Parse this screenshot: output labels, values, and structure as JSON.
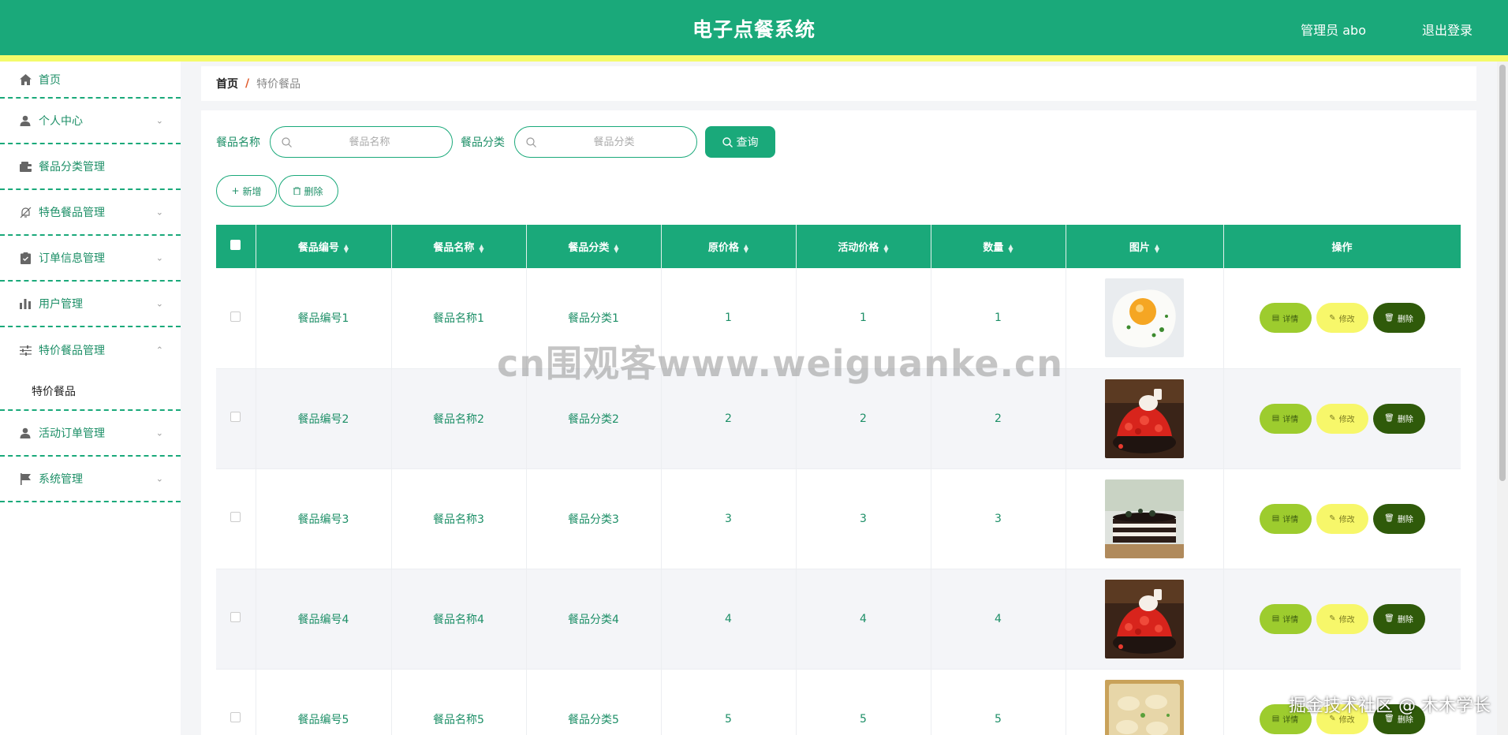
{
  "header": {
    "title": "电子点餐系统",
    "user": "管理员 abo",
    "logout": "退出登录"
  },
  "sidebar": {
    "items": [
      {
        "label": "首页",
        "icon": "home-icon"
      },
      {
        "label": "个人中心",
        "icon": "user-icon"
      },
      {
        "label": "餐品分类管理",
        "icon": "wallet-icon"
      },
      {
        "label": "特色餐品管理",
        "icon": "bell-off-icon"
      },
      {
        "label": "订单信息管理",
        "icon": "clipboard-icon"
      },
      {
        "label": "用户管理",
        "icon": "bar-chart-icon"
      },
      {
        "label": "特价餐品管理",
        "icon": "sliders-icon",
        "expanded": true,
        "children": [
          "特价餐品"
        ]
      },
      {
        "label": "活动订单管理",
        "icon": "user-icon"
      },
      {
        "label": "系统管理",
        "icon": "flag-icon"
      }
    ]
  },
  "breadcrumb": {
    "home": "首页",
    "separator": "/",
    "current": "特价餐品"
  },
  "search": {
    "name_label": "餐品名称",
    "name_placeholder": "餐品名称",
    "category_label": "餐品分类",
    "category_placeholder": "餐品分类",
    "query_button": "查询"
  },
  "actions": {
    "add": "新增",
    "delete": "删除"
  },
  "table": {
    "headers": [
      "餐品编号",
      "餐品名称",
      "餐品分类",
      "原价格",
      "活动价格",
      "数量",
      "图片",
      "操作"
    ],
    "rows": [
      {
        "code": "餐品编号1",
        "name": "餐品名称1",
        "category": "餐品分类1",
        "price": "1",
        "sale_price": "1",
        "qty": "1",
        "image": "fried-egg"
      },
      {
        "code": "餐品编号2",
        "name": "餐品名称2",
        "category": "餐品分类2",
        "price": "2",
        "sale_price": "2",
        "qty": "2",
        "image": "strawberry-ice"
      },
      {
        "code": "餐品编号3",
        "name": "餐品名称3",
        "category": "餐品分类3",
        "price": "3",
        "sale_price": "3",
        "qty": "3",
        "image": "layer-cake"
      },
      {
        "code": "餐品编号4",
        "name": "餐品名称4",
        "category": "餐品分类4",
        "price": "4",
        "sale_price": "4",
        "qty": "4",
        "image": "strawberry-ice"
      },
      {
        "code": "餐品编号5",
        "name": "餐品名称5",
        "category": "餐品分类5",
        "price": "5",
        "sale_price": "5",
        "qty": "5",
        "image": "dumplings"
      }
    ],
    "row_actions": {
      "detail": "详情",
      "edit": "修改",
      "delete": "删除"
    }
  },
  "watermark": "cn围观客www.weiguanke.cn",
  "corner_mark": "掘金技术社区 @ 木木学长",
  "colors": {
    "primary": "#1aa97a",
    "accent_yellow": "#f4fb6a",
    "detail_btn": "#9dcc2e",
    "edit_btn": "#f7f76a",
    "delete_btn": "#2f5a0a"
  }
}
